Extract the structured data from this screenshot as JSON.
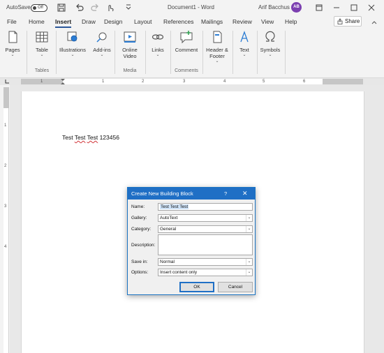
{
  "titlebar": {
    "autosave_label": "AutoSave",
    "autosave_state": "Off",
    "doc_title": "Document1 - Word",
    "user_name": "Arif Bacchus",
    "user_initials": "AB"
  },
  "menu": {
    "tabs": [
      "File",
      "Home",
      "Insert",
      "Draw",
      "Design",
      "Layout",
      "References",
      "Mailings",
      "Review",
      "View",
      "Help"
    ],
    "active_tab": "Insert",
    "share_label": "Share"
  },
  "ribbon": {
    "pages": {
      "label": "Pages",
      "dropdown": "⌄"
    },
    "table": {
      "label": "Table",
      "dropdown": "⌄"
    },
    "illustrations": {
      "label": "Illustrations",
      "dropdown": "⌄"
    },
    "addins": {
      "label": "Add-ins",
      "dropdown": "⌄"
    },
    "online_video": {
      "label": "Online Video"
    },
    "links": {
      "label": "Links",
      "dropdown": "⌄"
    },
    "comment": {
      "label": "Comment"
    },
    "header_footer": {
      "label": "Header & Footer",
      "dropdown": "⌄"
    },
    "text": {
      "label": "Text",
      "dropdown": "⌄"
    },
    "symbols": {
      "label": "Symbols",
      "dropdown": "⌄"
    },
    "groups": {
      "tables": "Tables",
      "media": "Media",
      "comments": "Comments"
    }
  },
  "ruler": {
    "h_numbers": [
      "1",
      "1",
      "2",
      "3",
      "4",
      "5",
      "6"
    ],
    "v_numbers": [
      "1",
      "2",
      "3",
      "4"
    ]
  },
  "document": {
    "text_plain": "Test ",
    "text_squiggle_1": "Test",
    "text_space": " ",
    "text_squiggle_2": "Test",
    "text_tail": " 123456"
  },
  "dialog": {
    "title": "Create New Building Block",
    "help": "?",
    "close": "✕",
    "fields": {
      "name_label": "Name:",
      "name_value": "Test Test Test",
      "gallery_label": "Gallery:",
      "gallery_value": "AutoText",
      "category_label": "Category:",
      "category_value": "General",
      "description_label": "Description:",
      "savein_label": "Save in:",
      "savein_value": "Normal",
      "options_label": "Options:",
      "options_value": "Insert content only"
    },
    "ok_label": "OK",
    "cancel_label": "Cancel"
  },
  "icons": {
    "dropdown_arrow": "⌄"
  }
}
